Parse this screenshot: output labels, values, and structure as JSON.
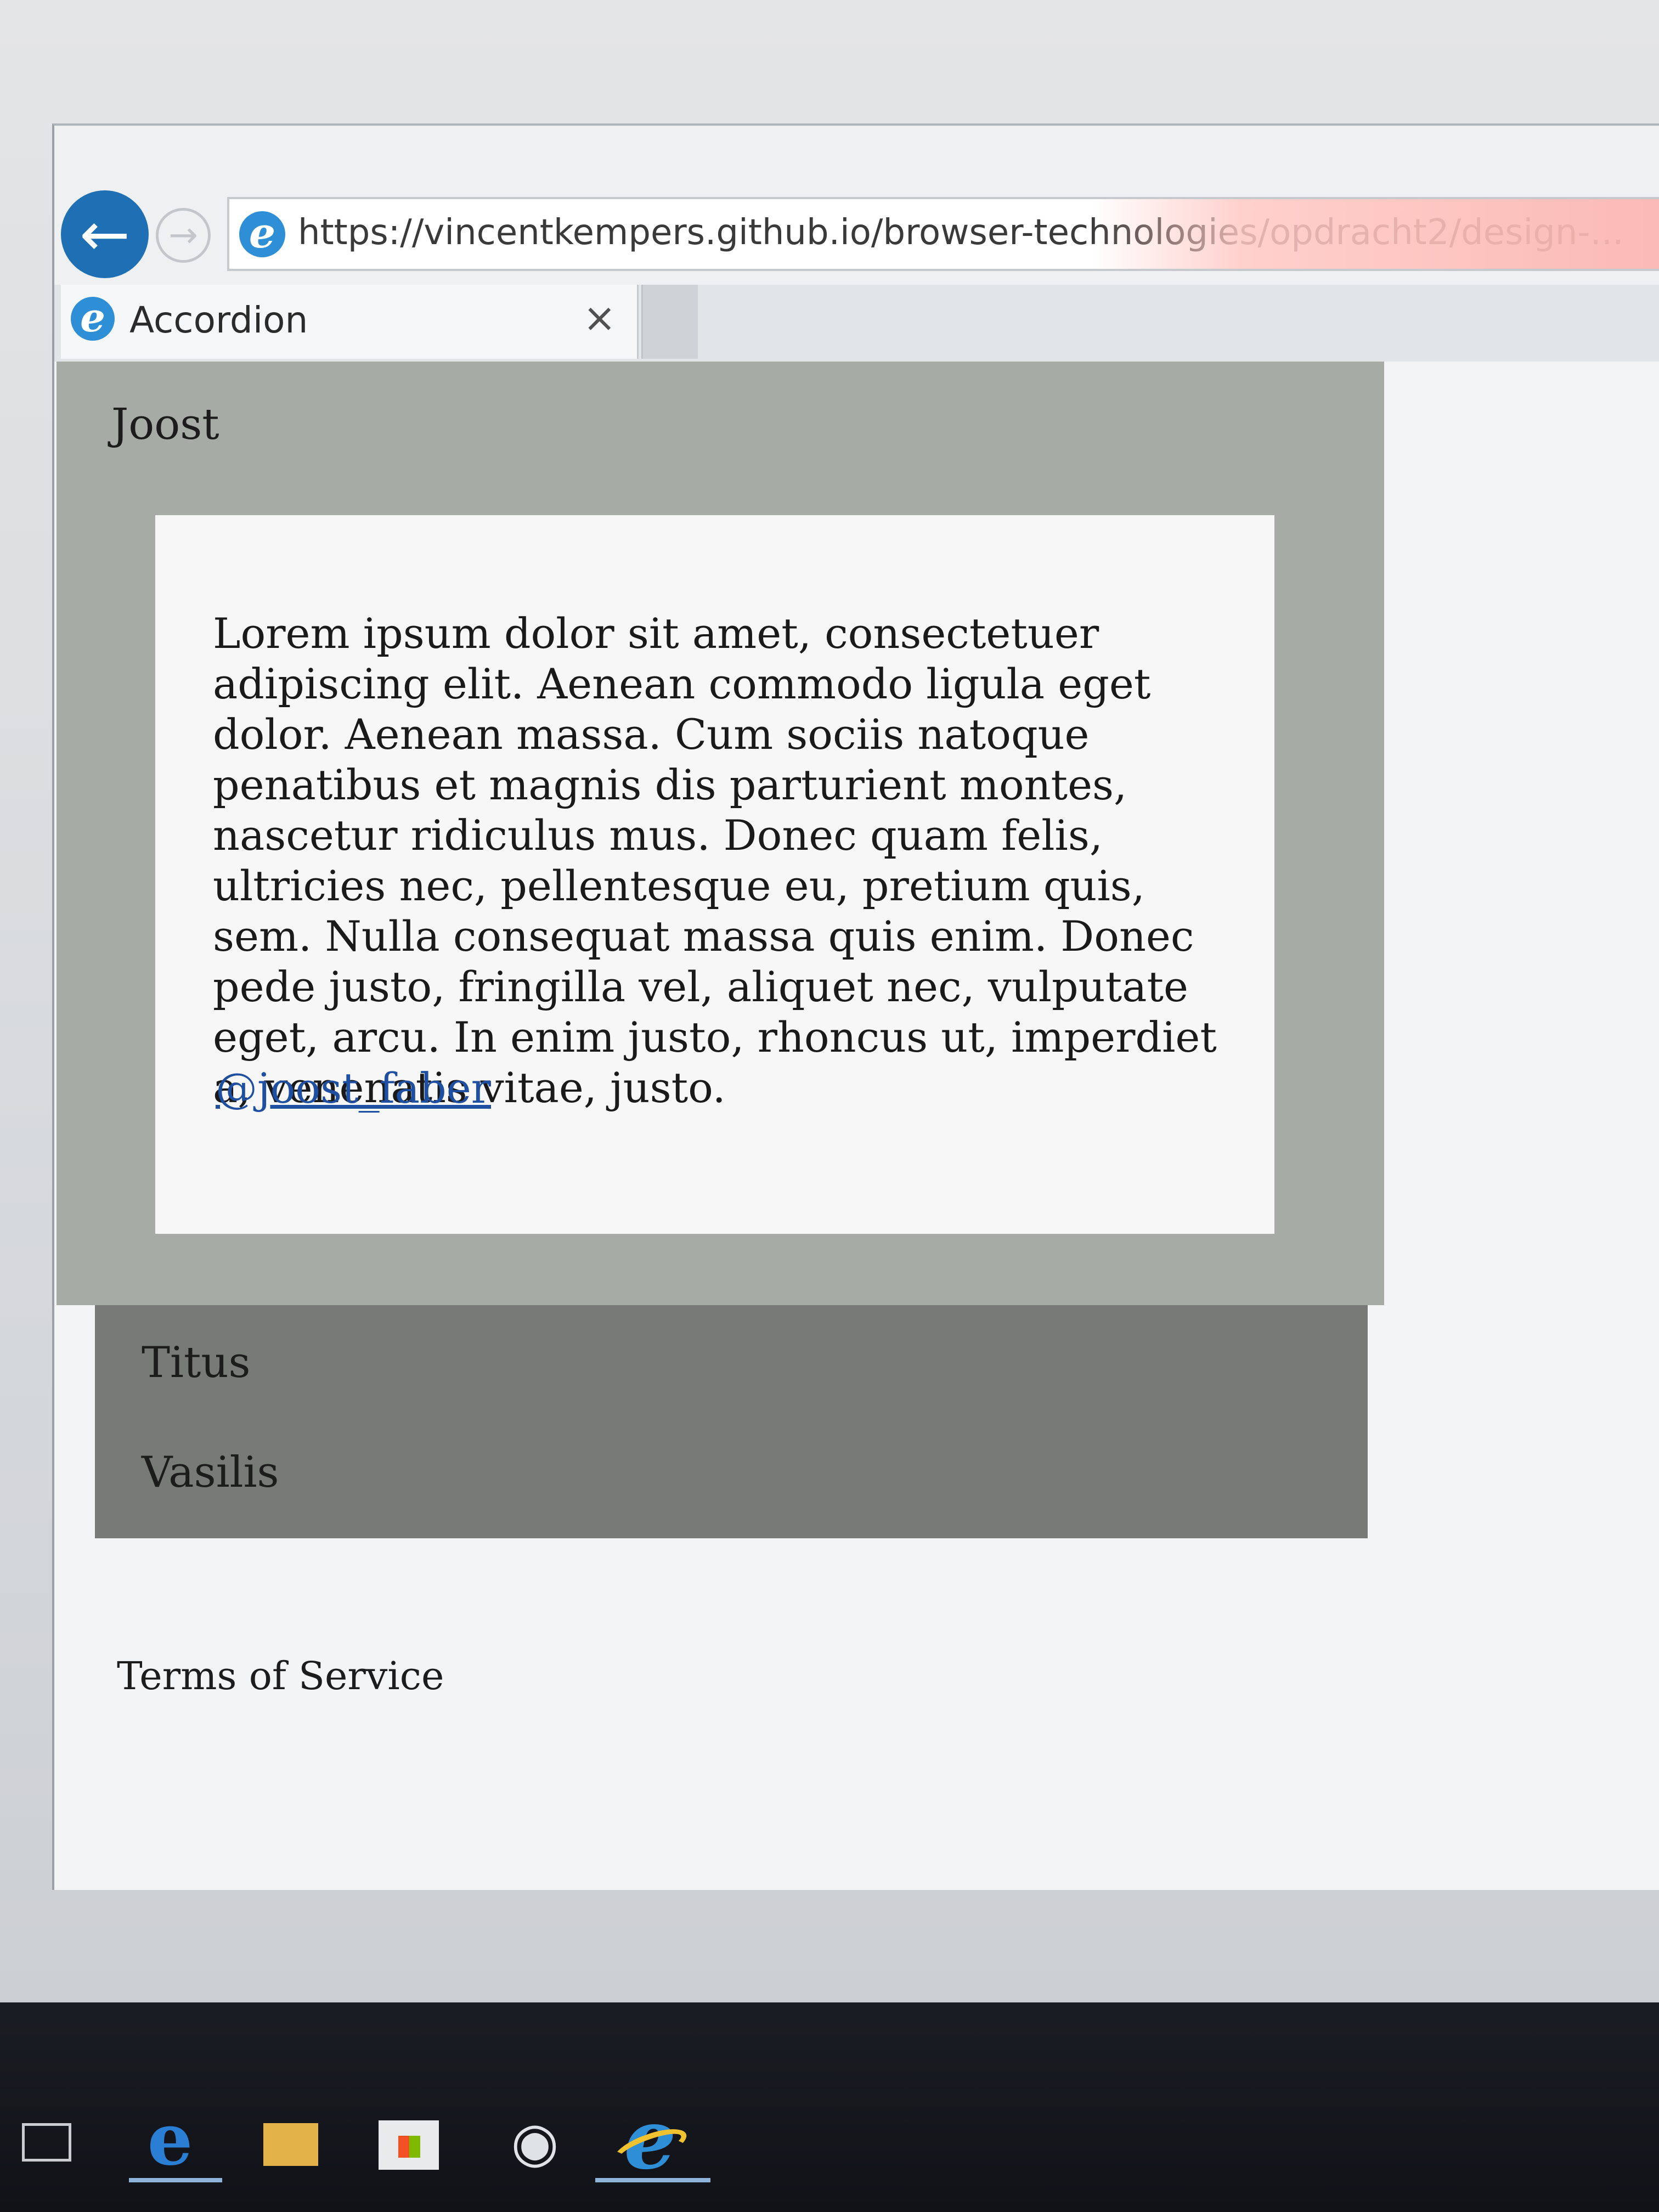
{
  "browser": {
    "url": "https://vincentkempers.github.io/browser-technologies/opdracht2/design-...",
    "tab": {
      "title": "Accordion",
      "close_glyph": "×"
    },
    "icons": {
      "back": "arrow-left-icon",
      "forward": "arrow-right-icon",
      "site": "ie-logo-icon"
    }
  },
  "accordion": {
    "open_panel": {
      "label": "Joost",
      "body": "Lorem ipsum dolor sit amet, consectetuer adipiscing elit. Aenean commodo ligula eget dolor. Aenean massa. Cum sociis natoque penatibus et magnis dis parturient montes, nascetur ridiculus mus. Donec quam felis, ultricies nec, pellentesque eu, pretium quis, sem. Nulla consequat massa quis enim. Donec pede justo, fringilla vel, aliquet nec, vulputate eget, arcu. In enim justo, rhoncus ut, imperdiet a, venenatis vitae, justo.",
      "link": "@joost_faber"
    },
    "closed_panels": [
      {
        "label": "Titus"
      },
      {
        "label": "Vasilis"
      }
    ]
  },
  "footer": {
    "terms": "Terms of Service"
  },
  "taskbar": {
    "icons": [
      "task-view-icon",
      "edge-icon",
      "file-explorer-icon",
      "store-icon",
      "app-icon",
      "internet-explorer-icon"
    ]
  },
  "colors": {
    "open_panel_bg": "#a7aba6",
    "closed_panel_bg": "#777a76",
    "link": "#1f4fa0",
    "back_button": "#1e6fb4"
  }
}
